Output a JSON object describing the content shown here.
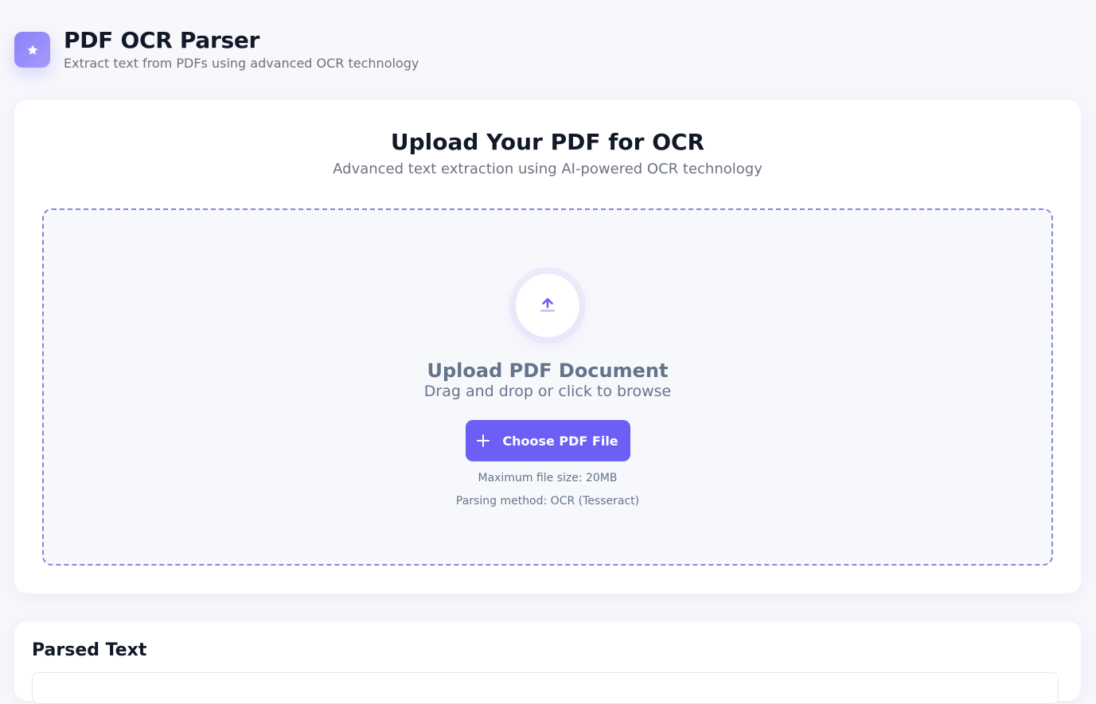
{
  "header": {
    "title": "PDF OCR Parser",
    "subtitle": "Extract text from PDFs using advanced OCR technology",
    "logo_icon": "star-icon"
  },
  "upload": {
    "heading": "Upload Your PDF for OCR",
    "subheading": "Advanced text extraction using AI-powered OCR technology",
    "dropzone": {
      "icon": "upload-arrow-icon",
      "title": "Upload PDF Document",
      "subtitle": "Drag and drop or click to browse",
      "button_label": "Choose PDF File",
      "button_icon": "plus-icon",
      "max_size": "Maximum file size: 20MB",
      "method": "Parsing method: OCR (Tesseract)"
    }
  },
  "parsed": {
    "title": "Parsed Text"
  },
  "colors": {
    "accent": "#6c5ff5",
    "dropzone_border": "#8b85d9",
    "background": "#f7f7fc"
  }
}
